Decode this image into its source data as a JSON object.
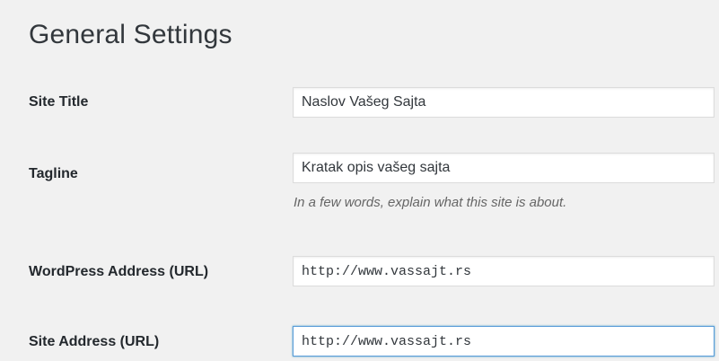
{
  "page": {
    "title": "General Settings"
  },
  "settings": {
    "site_title": {
      "label": "Site Title",
      "value": "Naslov Vašeg Sajta"
    },
    "tagline": {
      "label": "Tagline",
      "value": "Kratak opis vašeg sajta",
      "description": "In a few words, explain what this site is about."
    },
    "wordpress_address": {
      "label": "WordPress Address (URL)",
      "value": "http://www.vassajt.rs"
    },
    "site_address": {
      "label": "Site Address (URL)",
      "value": "http://www.vassajt.rs"
    }
  },
  "colors": {
    "background": "#f1f1f1",
    "focus_border": "#5b9dd9",
    "description_text": "#666666"
  }
}
